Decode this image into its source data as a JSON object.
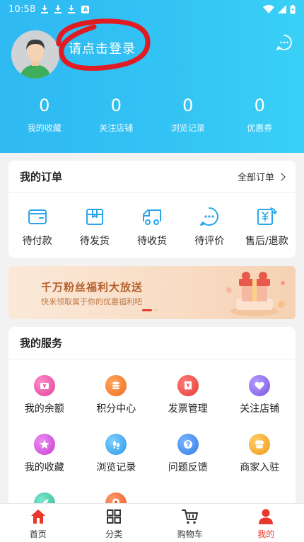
{
  "status_bar": {
    "time": "10:58"
  },
  "profile": {
    "login_prompt": "请点击登录"
  },
  "stats": [
    {
      "value": "0",
      "label": "我的收藏"
    },
    {
      "value": "0",
      "label": "关注店铺"
    },
    {
      "value": "0",
      "label": "浏览记录"
    },
    {
      "value": "0",
      "label": "优惠券"
    }
  ],
  "orders": {
    "title": "我的订单",
    "all_label": "全部订单",
    "items": [
      {
        "label": "待付款",
        "icon": "wallet-icon"
      },
      {
        "label": "待发货",
        "icon": "box-icon"
      },
      {
        "label": "待收货",
        "icon": "truck-icon"
      },
      {
        "label": "待评价",
        "icon": "chat-dots-icon"
      },
      {
        "label": "售后/退款",
        "icon": "refund-icon"
      }
    ]
  },
  "banner": {
    "headline": "千万粉丝福利大放送",
    "subline": "快来领取属于你的优惠福利吧"
  },
  "services": {
    "title": "我的服务",
    "items": [
      {
        "label": "我的余额",
        "icon": "yen-wallet-icon",
        "color": "#ea4fa8"
      },
      {
        "label": "积分中心",
        "icon": "coins-icon",
        "color": "#f47b2a"
      },
      {
        "label": "发票管理",
        "icon": "invoice-icon",
        "color": "#ee4a45"
      },
      {
        "label": "关注店铺",
        "icon": "heart-icon",
        "color": "#8a64e6"
      },
      {
        "label": "我的收藏",
        "icon": "star-icon",
        "color": "#d14fd8"
      },
      {
        "label": "浏览记录",
        "icon": "footprint-icon",
        "color": "#3aa9f3"
      },
      {
        "label": "问题反馈",
        "icon": "question-icon",
        "color": "#3b8df2"
      },
      {
        "label": "商家入驻",
        "icon": "shop-icon",
        "color": "#f5a623"
      },
      {
        "label": "",
        "icon": "rocket-icon",
        "color": "#3ec9a8"
      },
      {
        "label": "",
        "icon": "location-pin-icon",
        "color": "#f26b3a"
      }
    ]
  },
  "tabbar": {
    "items": [
      {
        "label": "首页",
        "icon": "home-icon"
      },
      {
        "label": "分类",
        "icon": "grid-icon"
      },
      {
        "label": "购物车",
        "icon": "cart-icon"
      },
      {
        "label": "我的",
        "icon": "user-icon"
      }
    ],
    "active": "我的"
  },
  "colors": {
    "header_start": "#2fb9f2",
    "header_end": "#3ad0f6",
    "accent_red": "#e8372b",
    "order_icon_blue": "#2aa6e8"
  }
}
